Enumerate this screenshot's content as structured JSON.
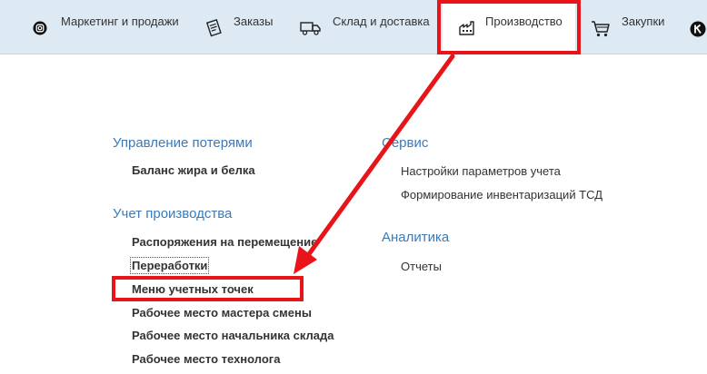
{
  "nav": {
    "items": [
      {
        "label": "Маркетинг и продажи",
        "icon": "instagram-like-icon"
      },
      {
        "label": "Заказы",
        "icon": "order-document-icon"
      },
      {
        "label": "Склад и доставка",
        "icon": "delivery-truck-icon"
      },
      {
        "label": "Производство",
        "icon": "factory-icon",
        "active": true
      },
      {
        "label": "Закупки",
        "icon": "shopping-cart-icon"
      }
    ]
  },
  "sections": {
    "losses": {
      "title": "Управление потерями",
      "items": [
        "Баланс жира и белка"
      ]
    },
    "production": {
      "title": "Учет производства",
      "items": [
        "Распоряжения на перемещение",
        "Переработки",
        "Меню учетных точек",
        "Рабочее место мастера смены",
        "Рабочее место начальника склада",
        "Рабочее место технолога"
      ]
    },
    "service": {
      "title": "Сервис",
      "items": [
        "Настройки параметров учета",
        "Формирование инвентаризаций ТСД"
      ]
    },
    "analytics": {
      "title": "Аналитика",
      "items": [
        "Отчеты"
      ]
    }
  },
  "colors": {
    "accent": "#3a7ab8",
    "annotation": "#e8141a",
    "topbar": "#dde9f3"
  }
}
